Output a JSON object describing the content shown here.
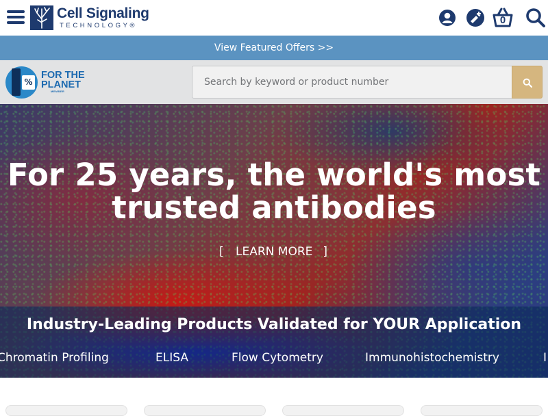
{
  "header": {
    "logo": {
      "name": "Cell Signaling",
      "tagline": "TECHNOLOGY®"
    },
    "menu_icon": "hamburger-menu-icon",
    "icons": [
      "account-icon",
      "protocol-icon",
      "cart-icon",
      "search-icon"
    ],
    "cart_count": "0",
    "brand_color": "#1e3a6e"
  },
  "promo": {
    "label": "View Featured Offers >>",
    "color": "#5b93c1"
  },
  "search": {
    "badge_logo": "1% FOR THE PLANET",
    "placeholder": "Search by keyword or product number",
    "button_color": "#d5b67f"
  },
  "hero": {
    "title": "For 25 years, the world's most trusted antibodies",
    "cta_open": "[",
    "cta_label": "LEARN MORE",
    "cta_close": "]",
    "band_title": "Industry-Leading Products Validated for YOUR Application",
    "applications": [
      "Chromatin Profiling",
      "ELISA",
      "Flow Cytometry",
      "Immunohistochemistry",
      "I"
    ]
  }
}
